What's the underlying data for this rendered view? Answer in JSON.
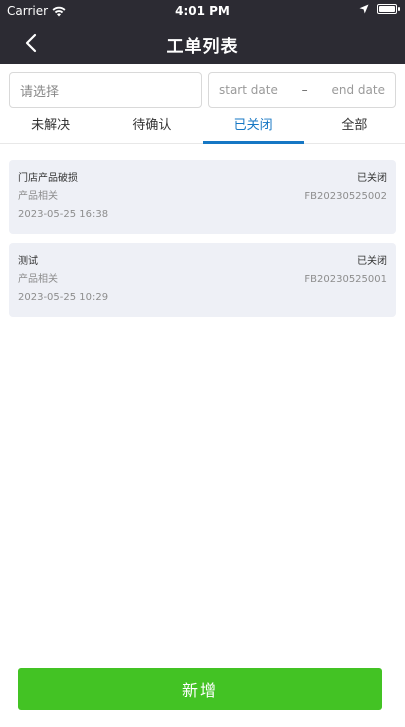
{
  "status_bar": {
    "carrier": "Carrier",
    "time": "4:01 PM"
  },
  "nav": {
    "title": "工单列表"
  },
  "filters": {
    "select_placeholder": "请选择",
    "start_placeholder": "start date",
    "separator": "–",
    "end_placeholder": "end date"
  },
  "tabs": [
    {
      "label": "未解决",
      "active": false
    },
    {
      "label": "待确认",
      "active": false
    },
    {
      "label": "已关闭",
      "active": true
    },
    {
      "label": "全部",
      "active": false
    }
  ],
  "tickets": [
    {
      "title": "门店产品破损",
      "status": "已关闭",
      "category": "产品相关",
      "id": "FB20230525002",
      "datetime": "2023-05-25 16:38"
    },
    {
      "title": "测试",
      "status": "已关闭",
      "category": "产品相关",
      "id": "FB20230525001",
      "datetime": "2023-05-25 10:29"
    }
  ],
  "add_button": {
    "label": "新增"
  },
  "colors": {
    "header_bg": "#2c2b33",
    "accent": "#1677c4",
    "card_bg": "#eef0f6",
    "button_green": "#43c324"
  }
}
